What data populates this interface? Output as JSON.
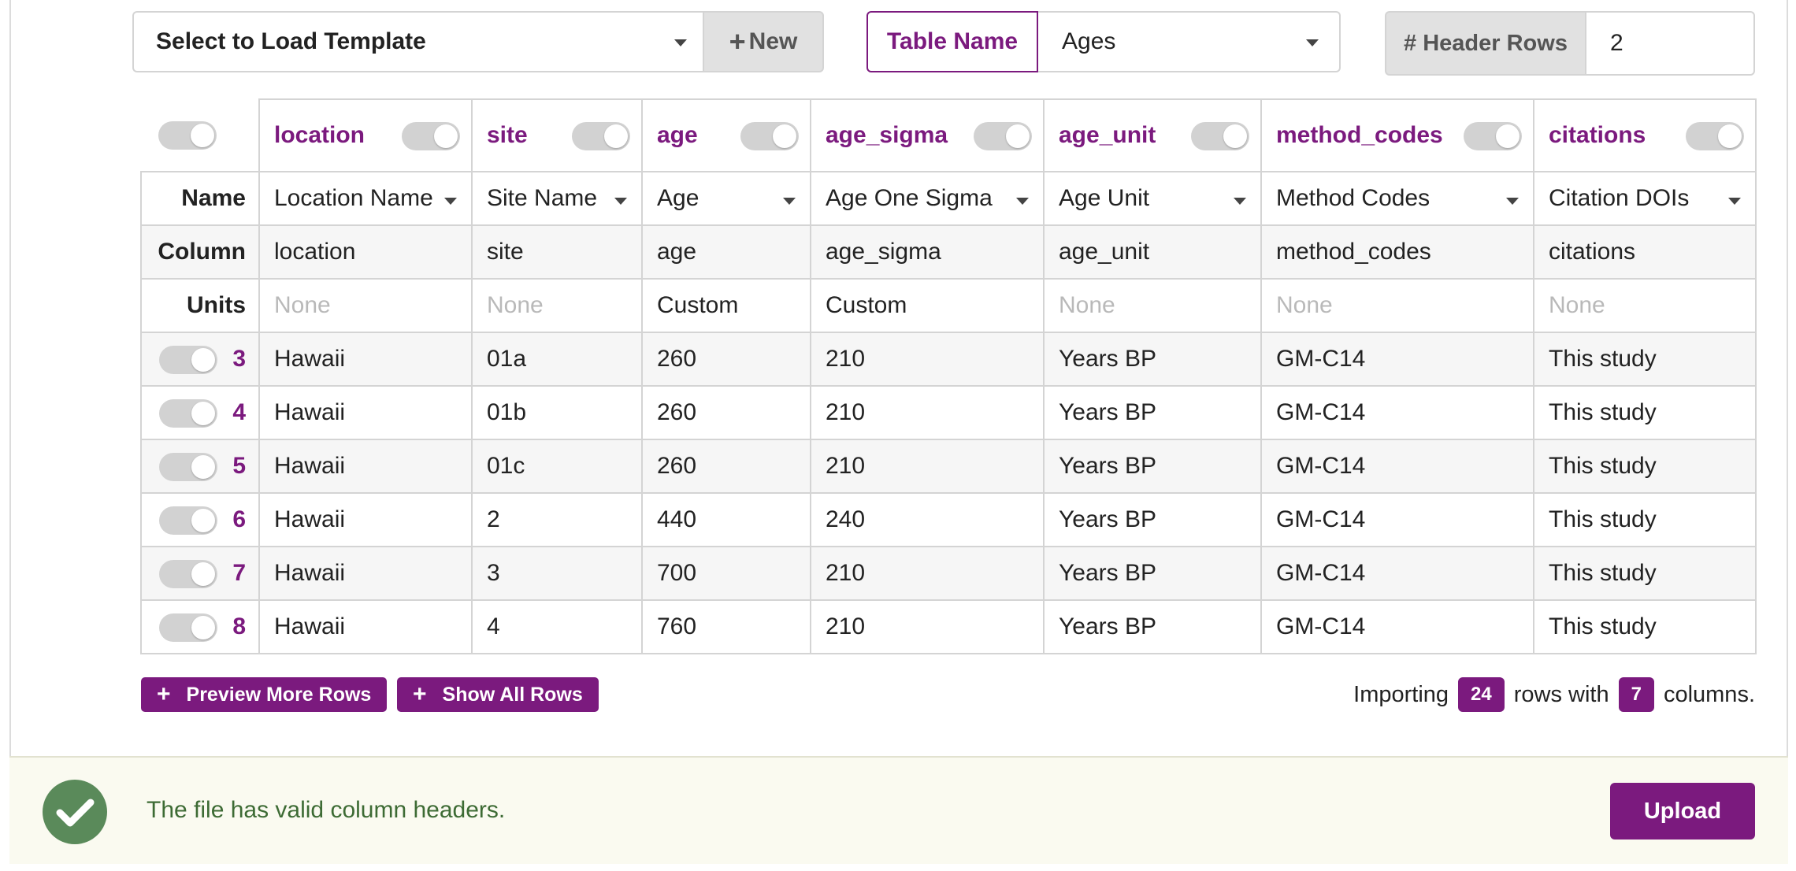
{
  "toolbar": {
    "template_placeholder": "Select to Load Template",
    "new_label": "New",
    "table_name_label": "Table Name",
    "table_name_value": "Ages",
    "header_rows_label": "# Header Rows",
    "header_rows_value": "2"
  },
  "table": {
    "row_labels": {
      "name": "Name",
      "column": "Column",
      "units": "Units"
    },
    "columns": [
      {
        "key": "location",
        "name": "Location Name",
        "column": "location",
        "units": "None"
      },
      {
        "key": "site",
        "name": "Site Name",
        "column": "site",
        "units": "None"
      },
      {
        "key": "age",
        "name": "Age",
        "column": "age",
        "units": "Custom"
      },
      {
        "key": "age_sigma",
        "name": "Age One Sigma",
        "column": "age_sigma",
        "units": "Custom"
      },
      {
        "key": "age_unit",
        "name": "Age Unit",
        "column": "age_unit",
        "units": "None"
      },
      {
        "key": "method_codes",
        "name": "Method Codes",
        "column": "method_codes",
        "units": "None"
      },
      {
        "key": "citations",
        "name": "Citation DOIs",
        "column": "citations",
        "units": "None"
      }
    ],
    "rows": [
      {
        "num": "3",
        "cells": [
          "Hawaii",
          "01a",
          "260",
          "210",
          "Years BP",
          "GM-C14",
          "This study"
        ]
      },
      {
        "num": "4",
        "cells": [
          "Hawaii",
          "01b",
          "260",
          "210",
          "Years BP",
          "GM-C14",
          "This study"
        ]
      },
      {
        "num": "5",
        "cells": [
          "Hawaii",
          "01c",
          "260",
          "210",
          "Years BP",
          "GM-C14",
          "This study"
        ]
      },
      {
        "num": "6",
        "cells": [
          "Hawaii",
          "2",
          "440",
          "240",
          "Years BP",
          "GM-C14",
          "This study"
        ]
      },
      {
        "num": "7",
        "cells": [
          "Hawaii",
          "3",
          "700",
          "210",
          "Years BP",
          "GM-C14",
          "This study"
        ]
      },
      {
        "num": "8",
        "cells": [
          "Hawaii",
          "4",
          "760",
          "210",
          "Years BP",
          "GM-C14",
          "This study"
        ]
      }
    ]
  },
  "actions": {
    "preview_more": "Preview More Rows",
    "show_all": "Show All Rows"
  },
  "summary": {
    "prefix": "Importing",
    "row_count": "24",
    "middle": "rows with",
    "column_count": "7",
    "suffix": "columns."
  },
  "footer": {
    "message": "The file has valid column headers.",
    "upload_label": "Upload"
  },
  "colors": {
    "accent": "#7b1a7e",
    "success": "#5a8a5a",
    "success_text": "#3d6b34"
  }
}
